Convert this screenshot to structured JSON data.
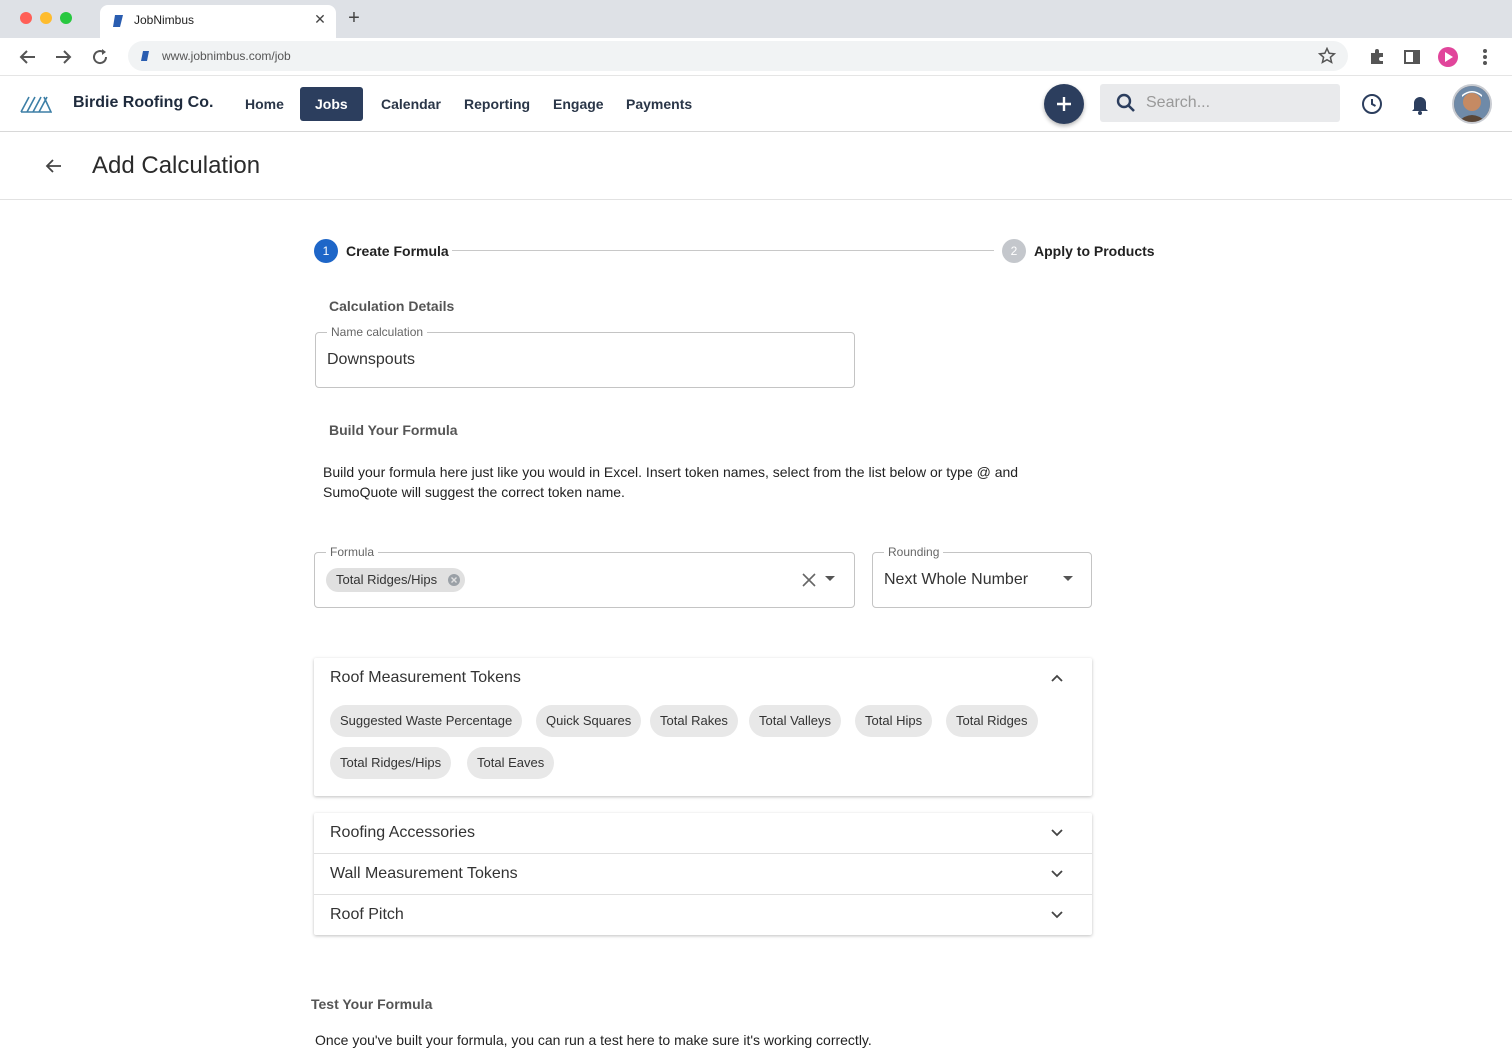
{
  "browser": {
    "tab_title": "JobNimbus",
    "url": "www.jobnimbus.com/job"
  },
  "header": {
    "company": "Birdie Roofing Co.",
    "nav": [
      "Home",
      "Jobs",
      "Calendar",
      "Reporting",
      "Engage",
      "Payments"
    ],
    "active_nav": "Jobs",
    "search_placeholder": "Search..."
  },
  "page": {
    "title": "Add Calculation"
  },
  "stepper": {
    "steps": [
      {
        "number": "1",
        "label": "Create Formula"
      },
      {
        "number": "2",
        "label": "Apply to Products"
      }
    ]
  },
  "details": {
    "section": "Calculation Details",
    "name_label": "Name calculation",
    "name_value": "Downspouts"
  },
  "formula": {
    "section": "Build Your Formula",
    "description": "Build your formula here just like you would in Excel. Insert token names, select from the list below or type @ and SumoQuote will suggest the correct token name.",
    "label": "Formula",
    "chip": "Total Ridges/Hips",
    "rounding_label": "Rounding",
    "rounding_value": "Next Whole Number"
  },
  "accordions": {
    "roof": {
      "title": "Roof Measurement Tokens",
      "tokens": [
        "Suggested Waste Percentage",
        "Quick Squares",
        "Total Rakes",
        "Total Valleys",
        "Total Hips",
        "Total Ridges",
        "Total Ridges/Hips",
        "Total Eaves"
      ]
    },
    "accessories": {
      "title": "Roofing Accessories"
    },
    "wall": {
      "title": "Wall Measurement Tokens"
    },
    "pitch": {
      "title": "Roof Pitch"
    }
  },
  "test": {
    "section": "Test Your Formula",
    "description": "Once you've built your formula, you can run a test here to make sure it's working correctly."
  },
  "colors": {
    "nav_active": "#2c3e5e",
    "step_active": "#1e66c8",
    "step_inactive": "#c4c7cc"
  }
}
